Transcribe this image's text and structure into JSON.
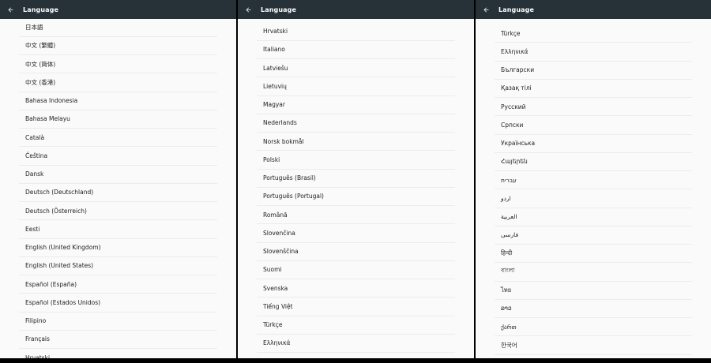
{
  "screens": [
    {
      "title": "Language",
      "items": [
        "日本語",
        "中文 (繁體)",
        "中文 (简体)",
        "中文 (香港)",
        "Bahasa Indonesia",
        "Bahasa Melayu",
        "Català",
        "Čeština",
        "Dansk",
        "Deutsch (Deutschland)",
        "Deutsch (Österreich)",
        "Eesti",
        "English (United Kingdom)",
        "English (United States)",
        "Español (España)",
        "Español (Estados Unidos)",
        "Filipino",
        "Français",
        "Hrvatski"
      ]
    },
    {
      "title": "Language",
      "items": [
        "Hrvatski",
        "Italiano",
        "Latviešu",
        "Lietuvių",
        "Magyar",
        "Nederlands",
        "Norsk bokmål",
        "Polski",
        "Português (Brasil)",
        "Português (Portugal)",
        "Română",
        "Slovenčina",
        "Slovenščina",
        "Suomi",
        "Svenska",
        "Tiếng Việt",
        "Türkçe",
        "Ελληνικά"
      ]
    },
    {
      "title": "Language",
      "items": [
        "Türkçe",
        "Ελληνικά",
        "Български",
        "Қазақ тілі",
        "Русский",
        "Српски",
        "Українська",
        "Հայերեն",
        "עברית",
        "اردو",
        "العربية",
        "فارسی",
        "हिन्दी",
        "বাংলা",
        "ไทย",
        "ລາວ",
        "ქართ",
        "한국어"
      ]
    }
  ],
  "icons": {
    "back": "arrow-back-icon"
  },
  "colors": {
    "appbar": "#263238",
    "background": "#fafafa",
    "text": "#212121"
  }
}
